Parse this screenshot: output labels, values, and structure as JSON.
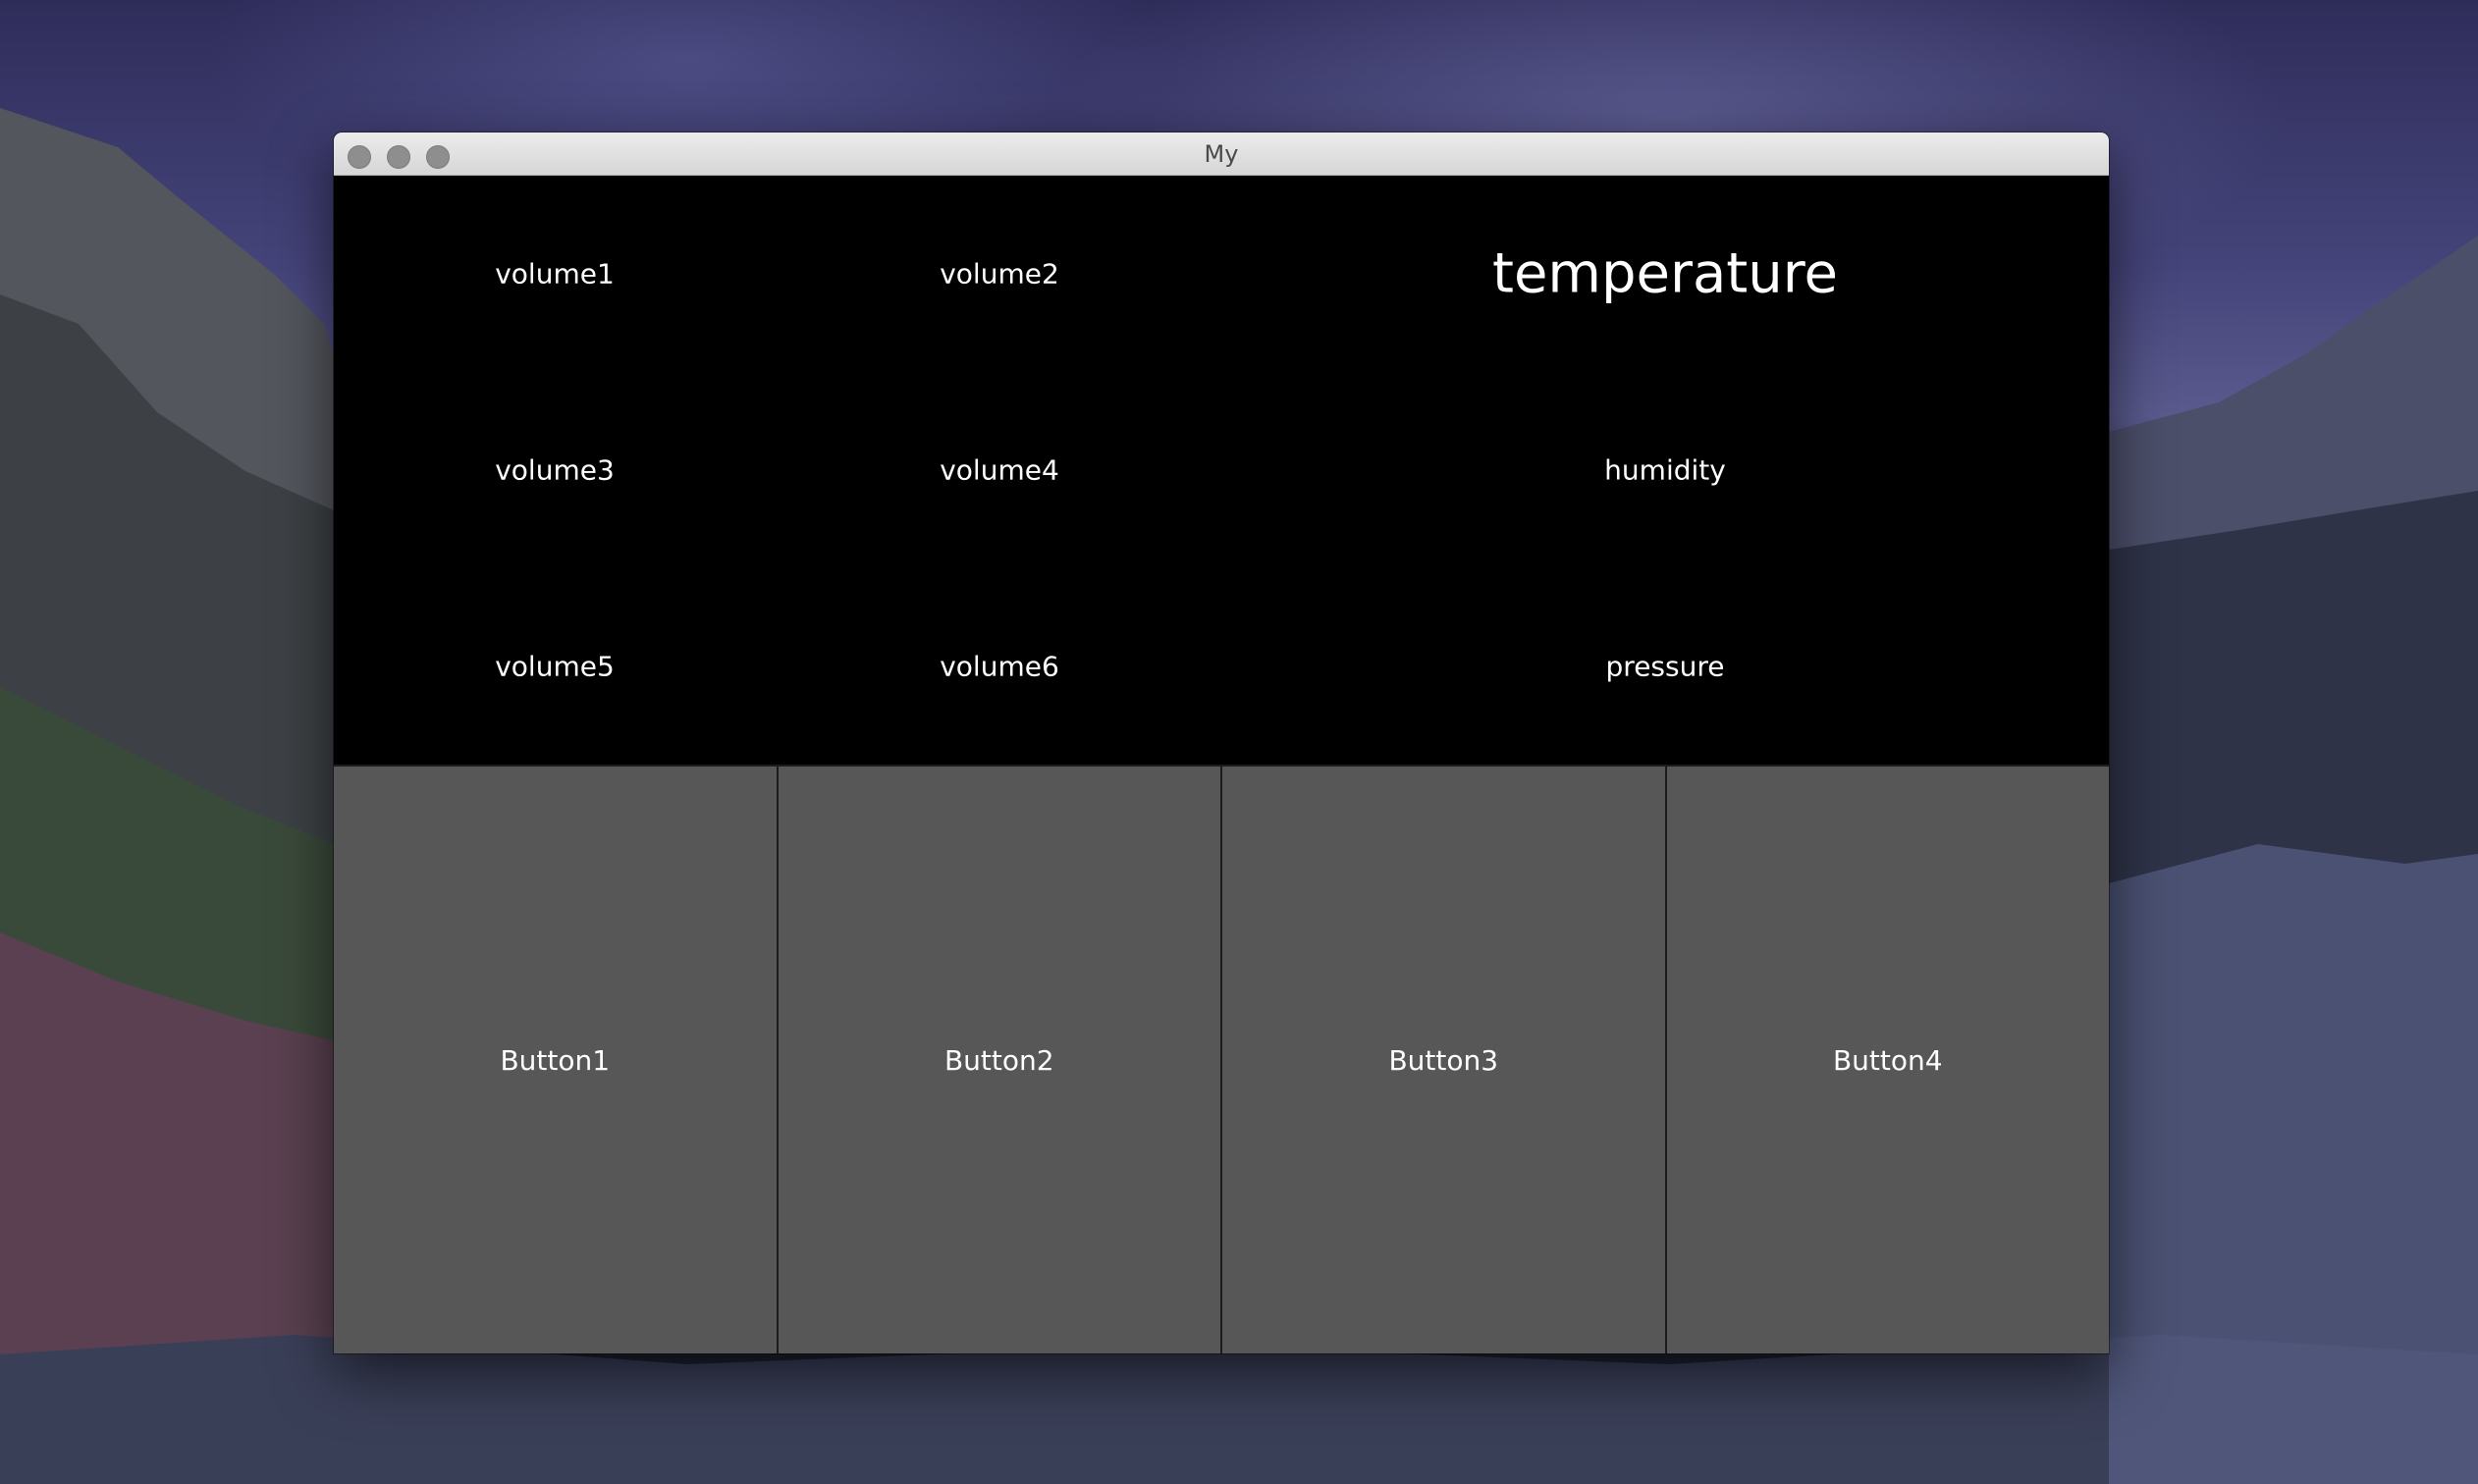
{
  "window": {
    "title": "My"
  },
  "readings": {
    "volume1": "volume1",
    "volume2": "volume2",
    "volume3": "volume3",
    "volume4": "volume4",
    "volume5": "volume5",
    "volume6": "volume6",
    "temperature": "temperature",
    "humidity": "humidity",
    "pressure": "pressure"
  },
  "buttons": [
    {
      "label": "Button1"
    },
    {
      "label": "Button2"
    },
    {
      "label": "Button3"
    },
    {
      "label": "Button4"
    }
  ],
  "colors": {
    "content_bg": "#000000",
    "button_bg": "#575757",
    "text": "#ffffff"
  }
}
